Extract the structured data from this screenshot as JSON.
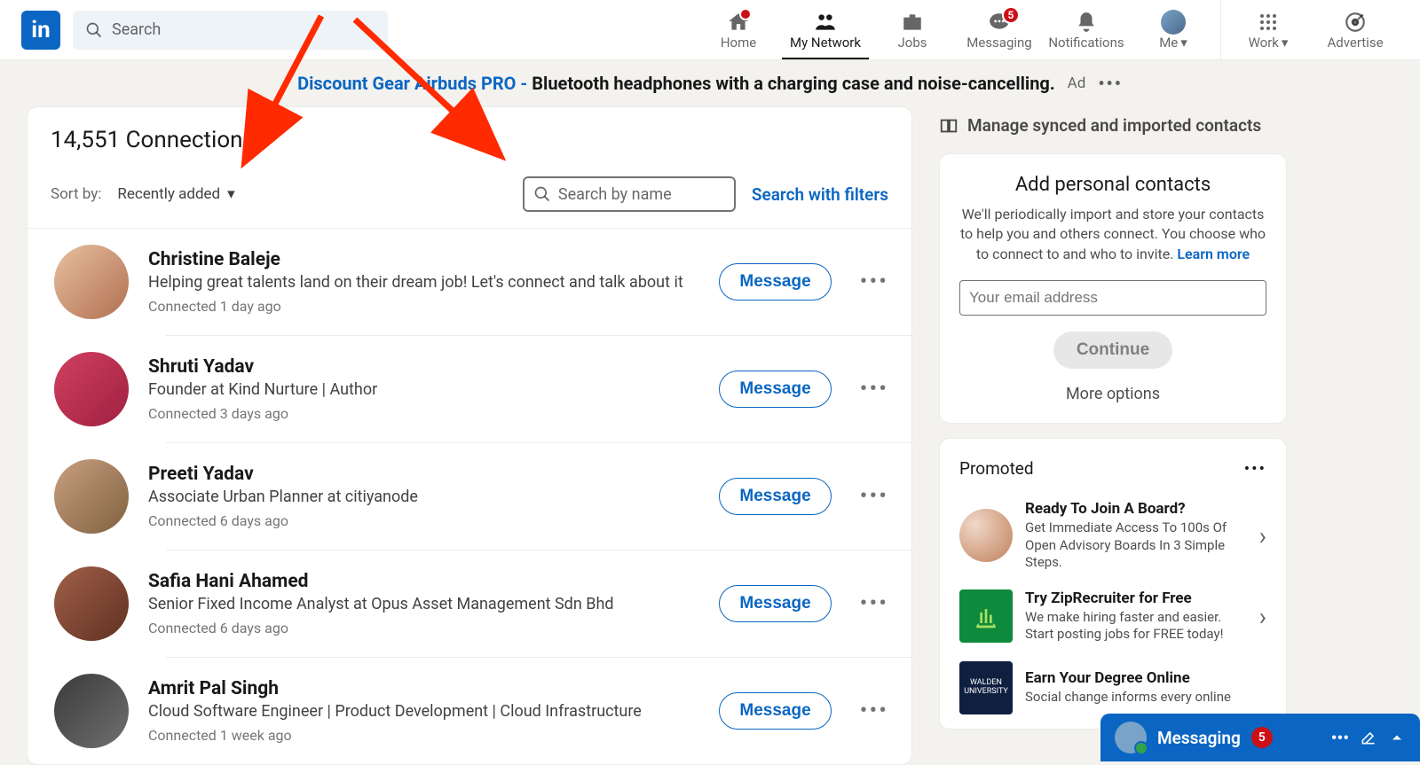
{
  "nav": {
    "search_placeholder": "Search",
    "items": [
      {
        "label": "Home",
        "icon": "home",
        "badge": ""
      },
      {
        "label": "My Network",
        "icon": "network",
        "active": true
      },
      {
        "label": "Jobs",
        "icon": "jobs"
      },
      {
        "label": "Messaging",
        "icon": "msg",
        "badge": "5"
      },
      {
        "label": "Notifications",
        "icon": "bell"
      },
      {
        "label": "Me",
        "icon": "me",
        "caret": true
      },
      {
        "label": "Work",
        "icon": "grid",
        "caret": true
      },
      {
        "label": "Advertise",
        "icon": "target"
      }
    ]
  },
  "ad": {
    "link": "Discount Gear Airbuds PRO -",
    "text": "Bluetooth headphones with a charging case and noise-cancelling.",
    "label": "Ad"
  },
  "connections": {
    "title": "14,551 Connections",
    "sort_label": "Sort by:",
    "sort_value": "Recently added",
    "search_placeholder": "Search by name",
    "filters_link": "Search with filters",
    "message_label": "Message",
    "items": [
      {
        "name": "Christine Baleje",
        "headline": "Helping great talents land on their dream job! Let's connect and talk about it",
        "when": "Connected 1 day ago"
      },
      {
        "name": "Shruti Yadav",
        "headline": "Founder at Kind Nurture | Author",
        "when": "Connected 3 days ago"
      },
      {
        "name": "Preeti Yadav",
        "headline": "Associate Urban Planner at citiyanode",
        "when": "Connected 6 days ago"
      },
      {
        "name": "Safia Hani Ahamed",
        "headline": "Senior Fixed Income Analyst at Opus Asset Management Sdn Bhd",
        "when": "Connected 6 days ago"
      },
      {
        "name": "Amrit Pal Singh",
        "headline": "Cloud Software Engineer | Product Development | Cloud Infrastructure",
        "when": "Connected 1 week ago"
      }
    ]
  },
  "sidebar": {
    "manage": "Manage synced and imported contacts",
    "personal": {
      "title": "Add personal contacts",
      "desc_a": "We'll periodically import and store your contacts to help you and others connect. You choose who to connect to and who to invite. ",
      "learn": "Learn more",
      "email_placeholder": "Your email address",
      "continue": "Continue",
      "more": "More options"
    },
    "promoted": {
      "title": "Promoted",
      "items": [
        {
          "title": "Ready To Join A Board?",
          "desc": "Get Immediate Access To 100s Of Open Advisory Boards In 3 Simple Steps."
        },
        {
          "title": "Try ZipRecruiter for Free",
          "desc": "We make hiring faster and easier. Start posting jobs for FREE today!"
        },
        {
          "title": "Earn Your Degree Online",
          "desc": "Social change informs every online"
        }
      ]
    }
  },
  "messaging_bubble": {
    "label": "Messaging",
    "count": "5"
  }
}
